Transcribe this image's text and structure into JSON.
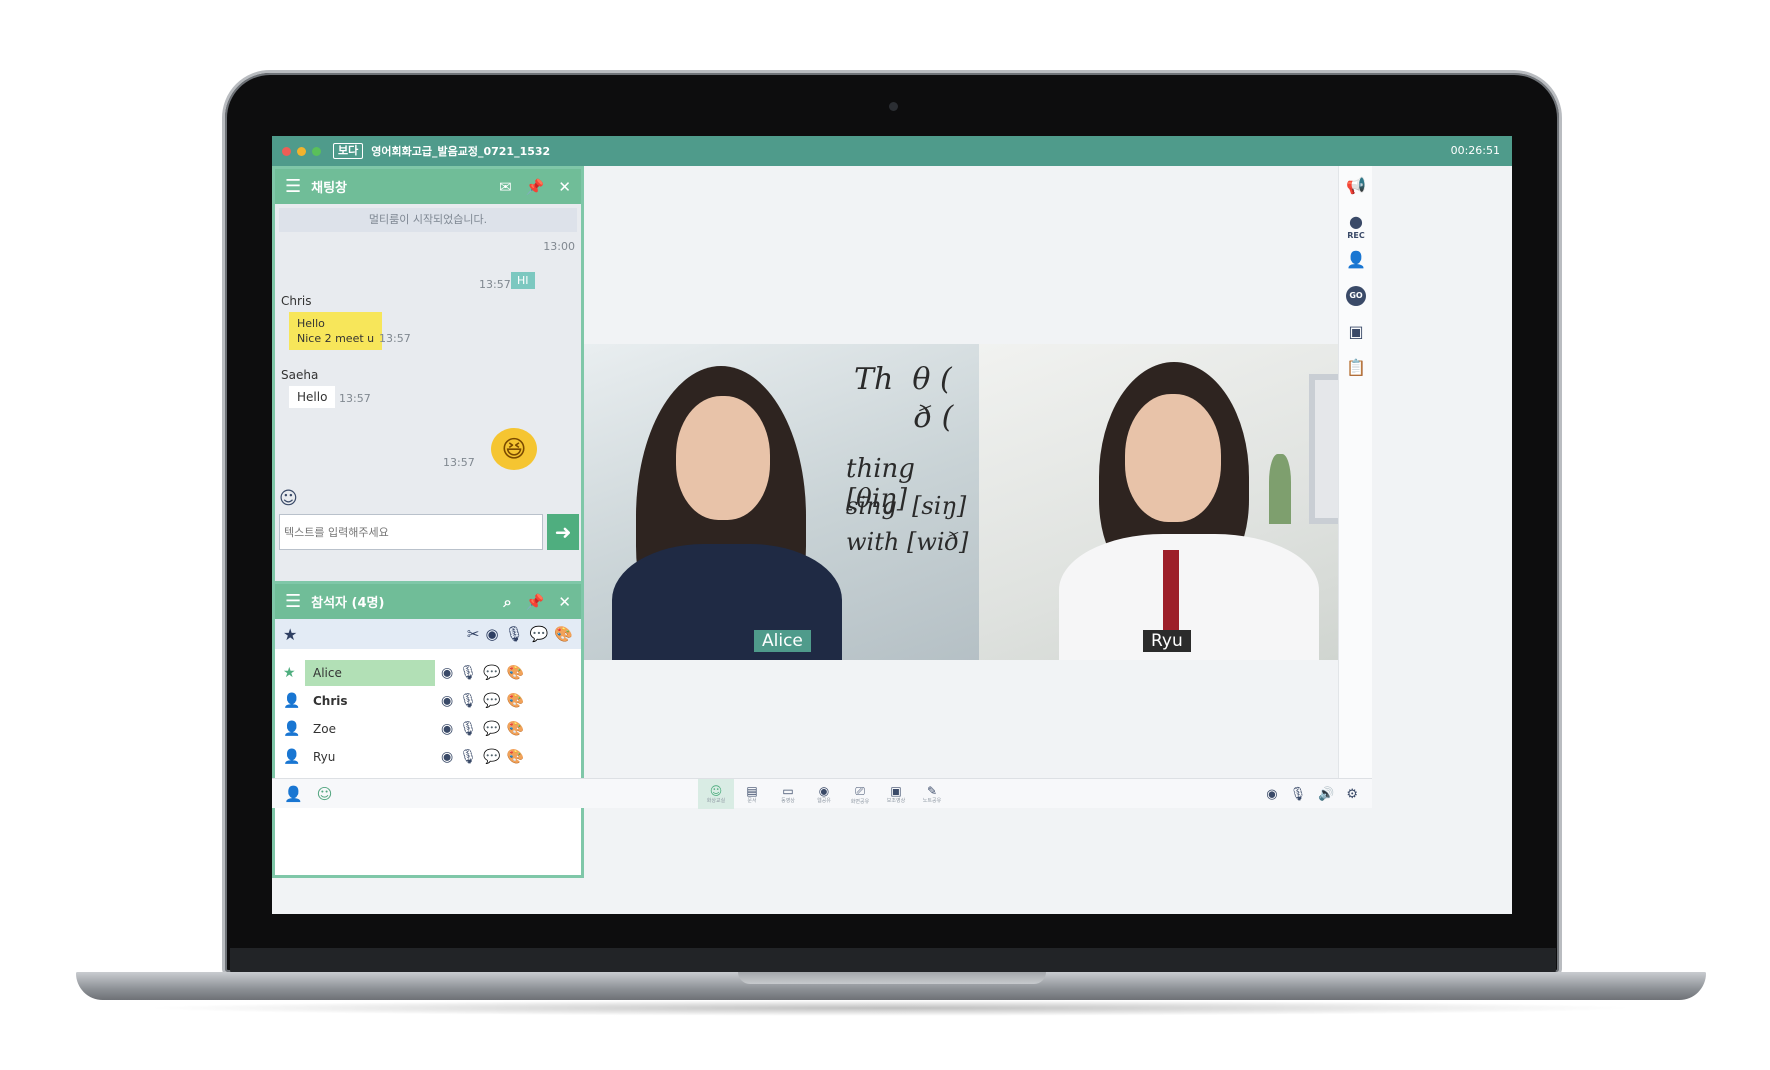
{
  "window": {
    "logo": "보다",
    "title": "영어회화고급_발음교정_0721_1532",
    "clock": "00:26:51"
  },
  "chat": {
    "header": "채팅창",
    "system_message": "멀티룸이 시작되었습니다.",
    "system_time": "13:00",
    "messages": [
      {
        "sender": "",
        "text": "HI",
        "time": "13:57"
      },
      {
        "sender": "Chris",
        "lines": [
          "Hello",
          "Nice 2 meet u"
        ],
        "time": "13:57"
      },
      {
        "sender": "Saeha",
        "text": "Hello",
        "time": "13:57"
      },
      {
        "sender": "",
        "emoji": "laughing-emoji",
        "time": "13:57"
      }
    ],
    "input_placeholder": "텍스트를 입력해주세요"
  },
  "participants": {
    "header": "참석자 (4명)",
    "list": [
      {
        "name": "Alice",
        "role": "host",
        "active": true
      },
      {
        "name": "Chris",
        "role": "member",
        "bold": true
      },
      {
        "name": "Zoe",
        "role": "member"
      },
      {
        "name": "Ryu",
        "role": "member"
      }
    ]
  },
  "videos": [
    {
      "name": "Alice",
      "tag_color": "#4f9b8b"
    },
    {
      "name": "Ryu",
      "tag_color": "#2b2b2b"
    }
  ],
  "right_tools": [
    "megaphone-icon",
    "rec-icon",
    "add-user-icon",
    "go-icon",
    "portrait-icon",
    "clipboard-icon"
  ],
  "rec_label": "REC",
  "go_label": "GO",
  "bottom_tools": [
    {
      "icon": "☺",
      "label": "화상교실"
    },
    {
      "icon": "▤",
      "label": "문서"
    },
    {
      "icon": "▭",
      "label": "동영상"
    },
    {
      "icon": "◉",
      "label": "웹공유"
    },
    {
      "icon": "⎚",
      "label": "화면공유"
    },
    {
      "icon": "▣",
      "label": "보조영상"
    },
    {
      "icon": "✎",
      "label": "노트공유"
    }
  ],
  "colors": {
    "accent": "#4f9b8b",
    "panel_header": "#70bd98",
    "highlight": "#b2e0b6"
  }
}
